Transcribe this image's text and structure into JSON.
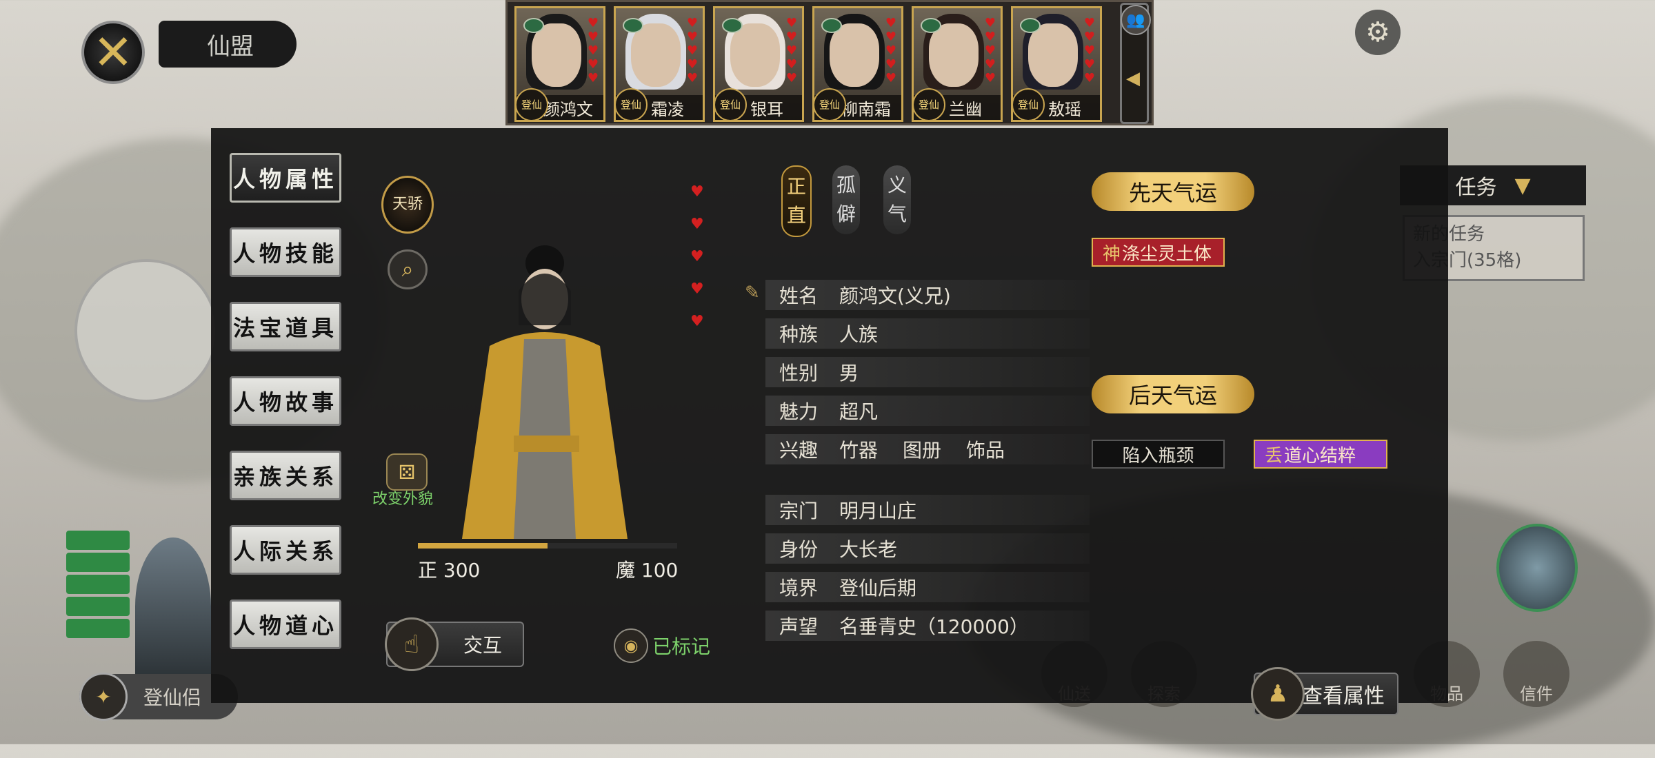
{
  "header": {
    "title": "仙盟",
    "close_icon": "close-icon",
    "settings_icon": "gear-icon"
  },
  "party": {
    "members": [
      {
        "name": "颜鸿文",
        "badge": "登仙",
        "hearts": 5,
        "hair": "#1a1a1a"
      },
      {
        "name": "霜凌",
        "badge": "登仙",
        "hearts": 5,
        "hair": "#d9dbe0"
      },
      {
        "name": "银耳",
        "badge": "登仙",
        "hearts": 5,
        "hair": "#e8e1db"
      },
      {
        "name": "柳南霜",
        "badge": "登仙",
        "hearts": 5,
        "hair": "#161616"
      },
      {
        "name": "兰幽",
        "badge": "登仙",
        "hearts": 5,
        "hair": "#2a1e1a"
      },
      {
        "name": "敖瑶",
        "badge": "登仙",
        "hearts": 5,
        "hair": "#1f1f2a"
      }
    ]
  },
  "menu": {
    "items": [
      "人物属性",
      "人物技能",
      "法宝道具",
      "人物故事",
      "亲族关系",
      "人际关系",
      "人物道心"
    ],
    "active": 0
  },
  "character": {
    "title_badge": "天骄",
    "change_look": "改变外貌",
    "hearts": 5,
    "good_label": "正 300",
    "evil_label": "魔 100",
    "alignment_fraction": 0.5,
    "interact": "交互",
    "marked": "已标记"
  },
  "traits": [
    {
      "chars": [
        "正",
        "直"
      ],
      "style": "gold"
    },
    {
      "chars": [
        "孤",
        "僻"
      ],
      "style": "grey"
    },
    {
      "chars": [
        "义",
        "气"
      ],
      "style": "grey"
    }
  ],
  "info": {
    "basic": [
      {
        "k": "姓名",
        "v": "颜鸿文(义兄)"
      },
      {
        "k": "种族",
        "v": "人族"
      },
      {
        "k": "性别",
        "v": "男"
      },
      {
        "k": "魅力",
        "v": "超凡"
      }
    ],
    "hobby_label": "兴趣",
    "hobbies": [
      "竹器",
      "图册",
      "饰品"
    ],
    "status": [
      {
        "k": "宗门",
        "v": "明月山庄"
      },
      {
        "k": "身份",
        "v": "大长老"
      },
      {
        "k": "境界",
        "v": "登仙后期"
      },
      {
        "k": "声望",
        "v": "名垂青史（120000）"
      }
    ]
  },
  "fortune": {
    "innate_title": "先天气运",
    "innate_tags": [
      {
        "label": "涤尘灵土体",
        "icon": "神"
      }
    ],
    "acquired_title": "后天气运",
    "acquired_tags": [
      {
        "label": "陷入瓶颈"
      },
      {
        "label": "道心结粹",
        "icon": "丢"
      }
    ]
  },
  "view_attributes": "查看属性",
  "world": {
    "task_header": "任务",
    "task_lines": [
      "新的任务",
      "入宗门(35格)"
    ],
    "bottom_left_button": "登仙侣",
    "dock": [
      "仙送",
      "探索",
      "",
      "物品",
      "信件"
    ]
  },
  "colors": {
    "gold": "#d3a640",
    "heart": "#d21e1e",
    "marked_green": "#7dd26b"
  }
}
